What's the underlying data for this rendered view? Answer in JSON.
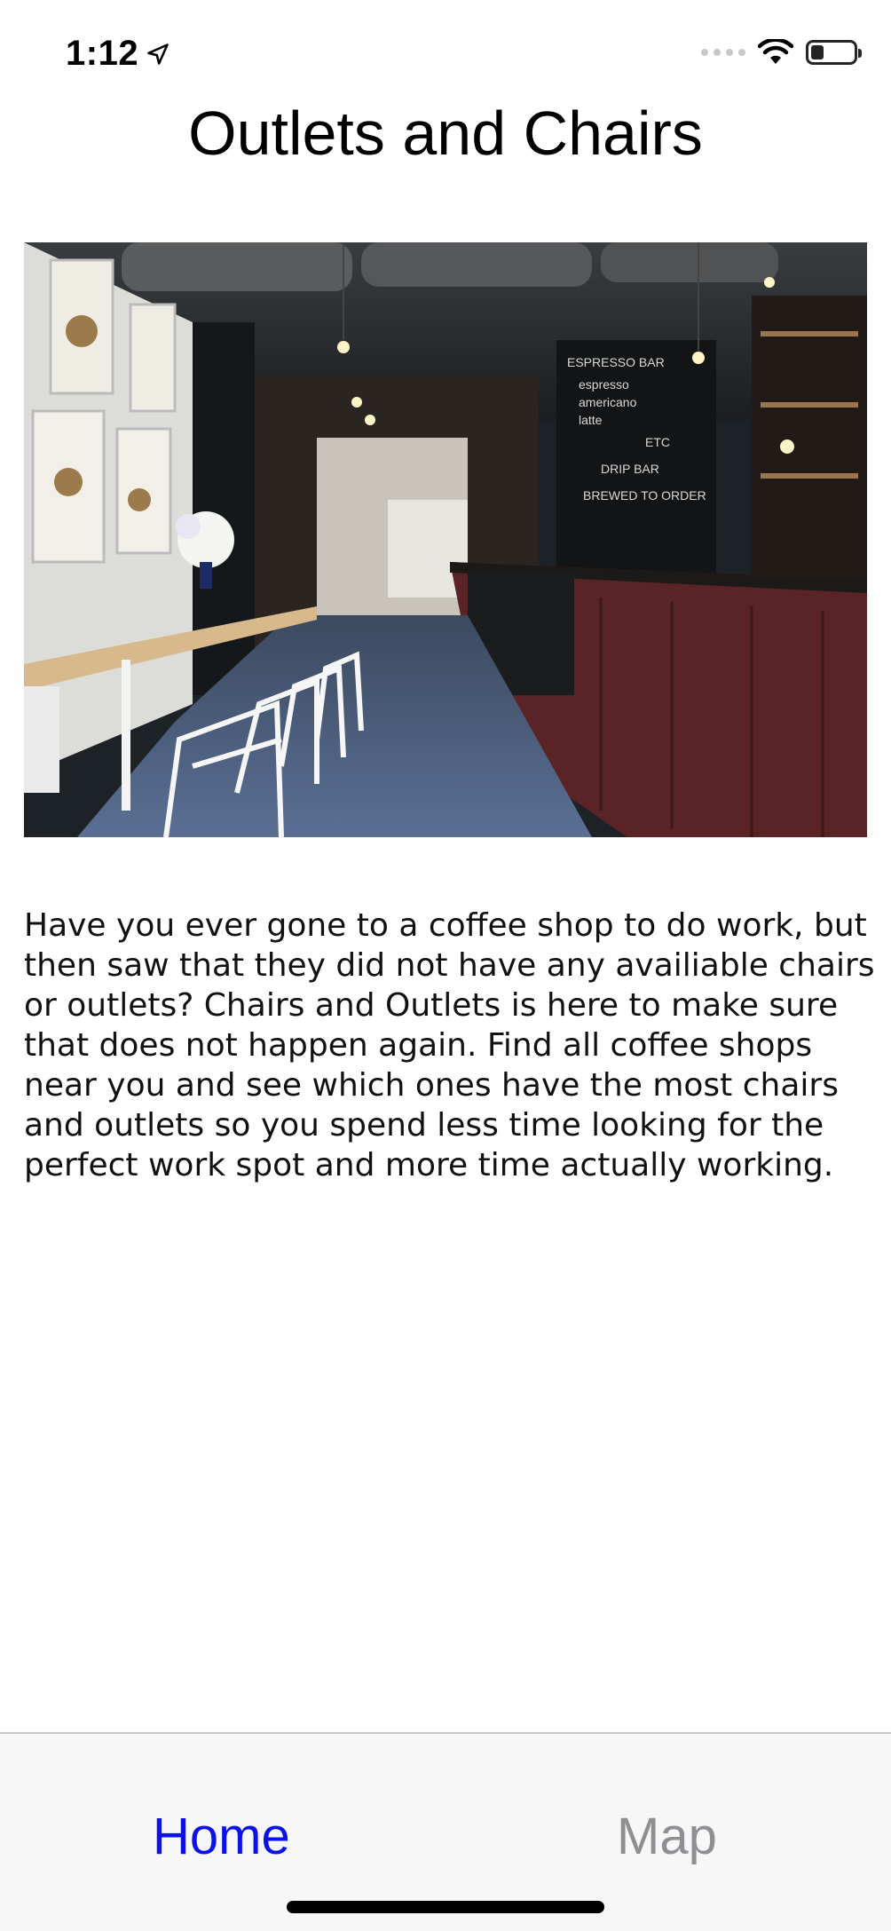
{
  "status_bar": {
    "time": "1:12",
    "location_icon": "location-arrow-icon",
    "signal_icon": "signal-dots-icon",
    "wifi_icon": "wifi-icon",
    "battery_icon": "battery-icon",
    "battery_level": 0.3
  },
  "header": {
    "title": "Outlets and Chairs"
  },
  "main": {
    "hero_image": "coffee-shop-interior-photo",
    "description": "Have you ever gone to a coffee shop to do work, but then saw that they did not have any availiable chairs or outlets? Chairs and Outlets is here to make sure that does not happen again. Find all coffee shops near you and see which ones have the most chairs and outlets so you spend less time looking for the perfect work spot and more time actually working."
  },
  "tabbar": {
    "tabs": [
      {
        "label": "Home",
        "selected": true
      },
      {
        "label": "Map",
        "selected": false
      }
    ]
  },
  "colors": {
    "accent": "#0b12e8",
    "inactive_tab": "#8e8e93",
    "tabbar_bg": "#f7f7f7"
  }
}
